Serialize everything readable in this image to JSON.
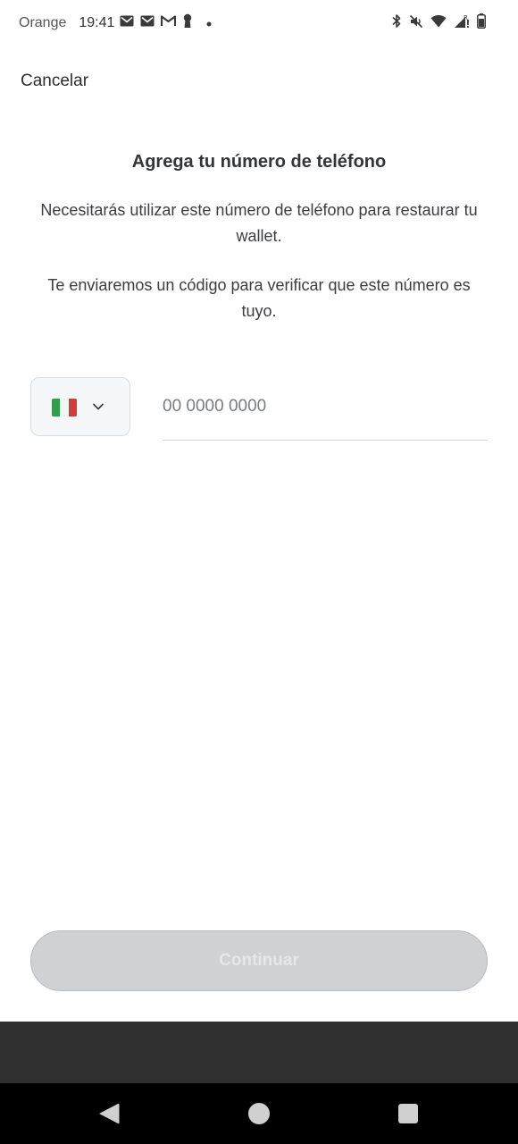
{
  "status_bar": {
    "carrier": "Orange",
    "time": "19:41",
    "icons": [
      "gmail-icon",
      "gmail-icon",
      "gmail-icon",
      "keyhole-icon",
      "dot-icon",
      "bluetooth-icon",
      "mute-icon",
      "wifi-icon",
      "signal-roaming-icon",
      "battery-icon"
    ]
  },
  "header": {
    "cancel_label": "Cancelar"
  },
  "main": {
    "title": "Agrega tu número de teléfono",
    "description_1": "Necesitarás utilizar este número de teléfono para restaurar tu wallet.",
    "description_2": "Te enviaremos un código para verificar que este número es tuyo.",
    "country_selector": {
      "selected_flag": "italy-flag-icon",
      "flag_colors": [
        "#2f9e4f",
        "#f4f4f4",
        "#d33a3a"
      ]
    },
    "phone_input": {
      "value": "",
      "placeholder": "00 0000 0000"
    }
  },
  "footer": {
    "continue_label": "Continuar",
    "continue_enabled": false
  },
  "nav_bar": {
    "icons": [
      "back-icon",
      "home-icon",
      "recents-icon"
    ]
  },
  "colors": {
    "button_disabled_bg": "#d0d1d3",
    "button_disabled_text": "#e6e7e8",
    "text_primary": "#333538",
    "nav_bar": "#000000",
    "dark_band": "#303030"
  }
}
